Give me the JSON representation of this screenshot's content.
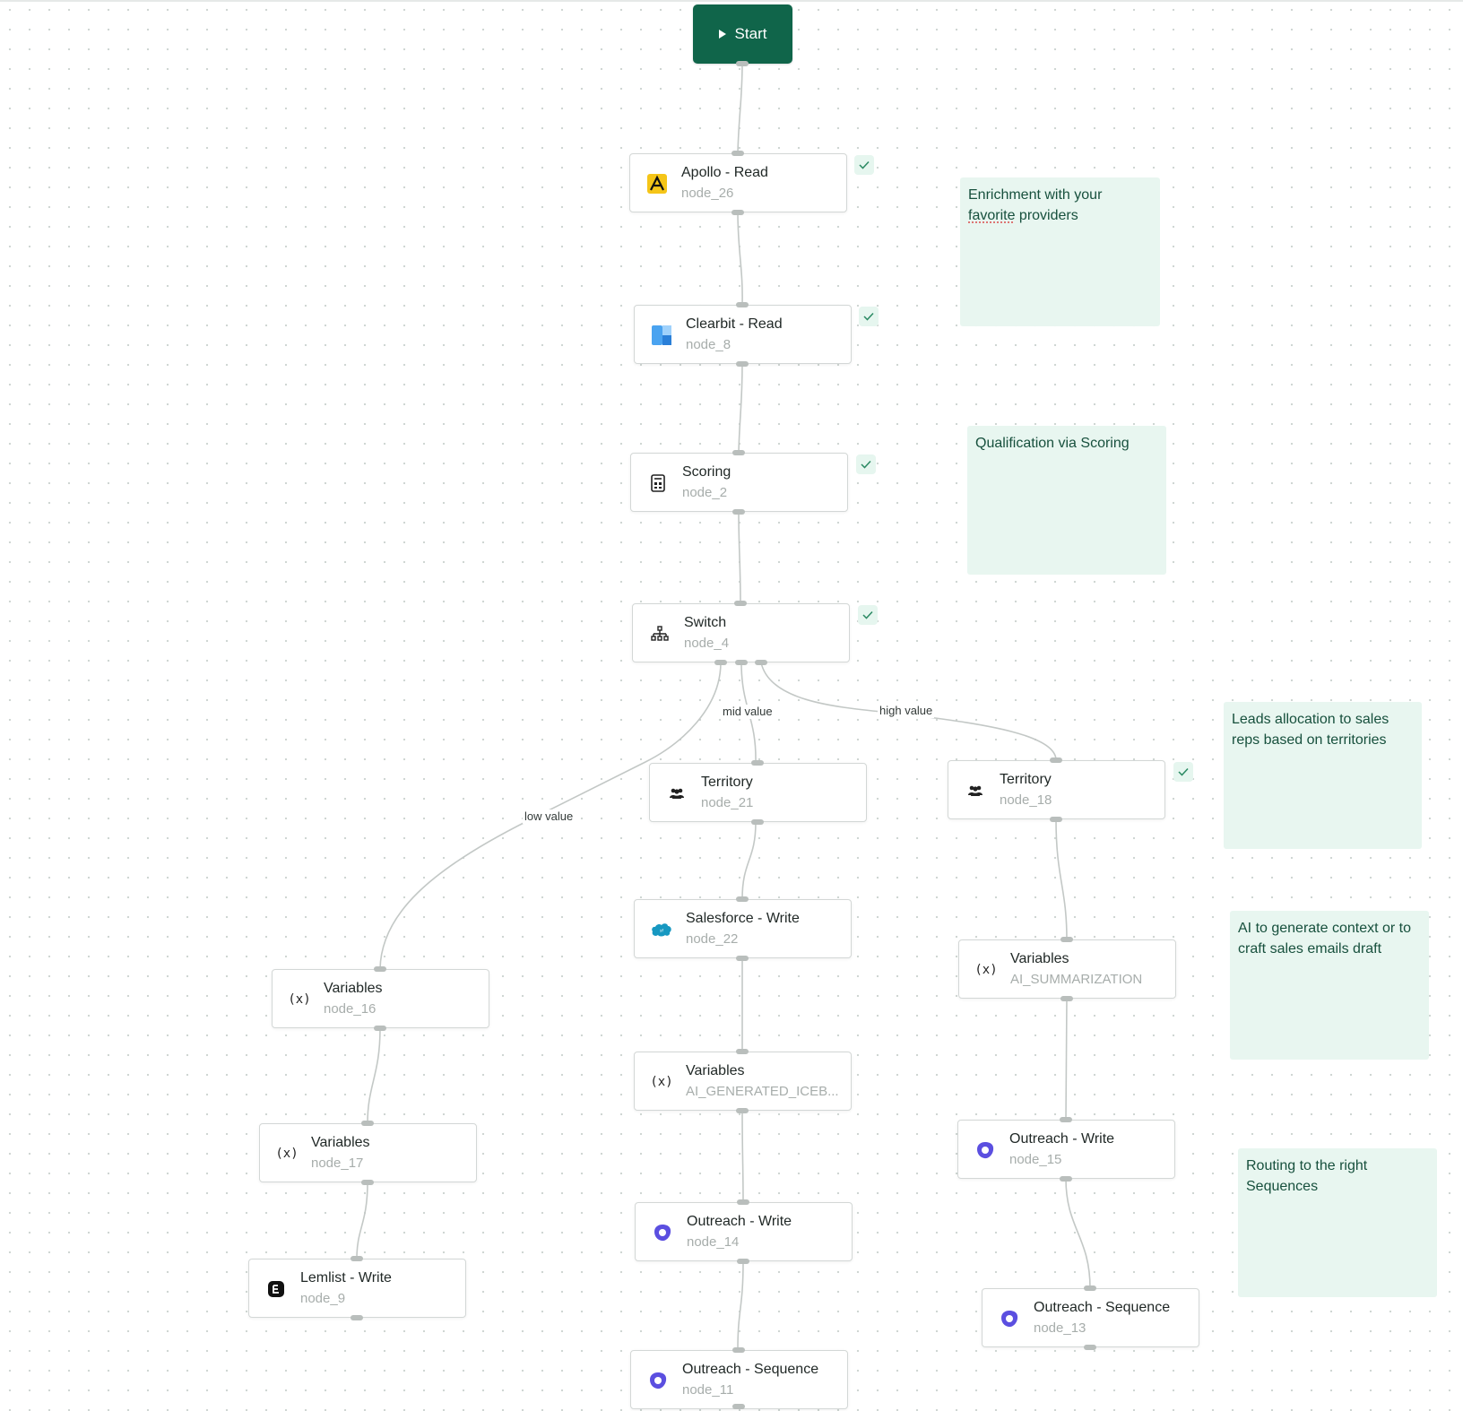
{
  "start": {
    "label": "Start"
  },
  "nodes": {
    "apollo": {
      "title": "Apollo - Read",
      "sub": "node_26",
      "icon": "apollo-logo-icon"
    },
    "clearbit": {
      "title": "Clearbit - Read",
      "sub": "node_8",
      "icon": "clearbit-logo-icon"
    },
    "scoring": {
      "title": "Scoring",
      "sub": "node_2",
      "icon": "calculator-icon"
    },
    "switch": {
      "title": "Switch",
      "sub": "node_4",
      "icon": "branch-icon"
    },
    "territory21": {
      "title": "Territory",
      "sub": "node_21",
      "icon": "users-icon"
    },
    "territory18": {
      "title": "Territory",
      "sub": "node_18",
      "icon": "users-icon"
    },
    "salesforce": {
      "title": "Salesforce - Write",
      "sub": "node_22",
      "icon": "salesforce-logo-icon"
    },
    "vars16": {
      "title": "Variables",
      "sub": "node_16",
      "icon": "variable-icon"
    },
    "vars17": {
      "title": "Variables",
      "sub": "node_17",
      "icon": "variable-icon"
    },
    "varsAiSum": {
      "title": "Variables",
      "sub": "AI_SUMMARIZATION",
      "icon": "variable-icon"
    },
    "varsIceb": {
      "title": "Variables",
      "sub": "AI_GENERATED_ICEB...",
      "icon": "variable-icon"
    },
    "outreach15": {
      "title": "Outreach - Write",
      "sub": "node_15",
      "icon": "outreach-logo-icon"
    },
    "outreach14": {
      "title": "Outreach - Write",
      "sub": "node_14",
      "icon": "outreach-logo-icon"
    },
    "lemlist": {
      "title": "Lemlist - Write",
      "sub": "node_9",
      "icon": "lemlist-logo-icon"
    },
    "seq13": {
      "title": "Outreach - Sequence",
      "sub": "node_13",
      "icon": "outreach-logo-icon"
    },
    "seq11": {
      "title": "Outreach - Sequence",
      "sub": "node_11",
      "icon": "outreach-logo-icon"
    }
  },
  "edge_labels": {
    "mid": "mid value",
    "high": "high value",
    "low": "low value"
  },
  "notes": {
    "enrichment_a": "Enrichment with your",
    "enrichment_b_word": "favorite",
    "enrichment_b_rest": " providers",
    "qualification": "Qualification via Scoring",
    "leads": "Leads allocation to sales reps based on territories",
    "ai": "AI to generate context or to craft sales emails draft",
    "routing": "Routing to the right Sequences"
  },
  "colors": {
    "start_bg": "#10654a",
    "note_bg": "#e8f6f0",
    "note_text": "#17503d",
    "edge": "#c3c8c6",
    "outreach": "#5b4fe0",
    "apollo": "#f5c518",
    "salesforce": "#1798c1"
  }
}
